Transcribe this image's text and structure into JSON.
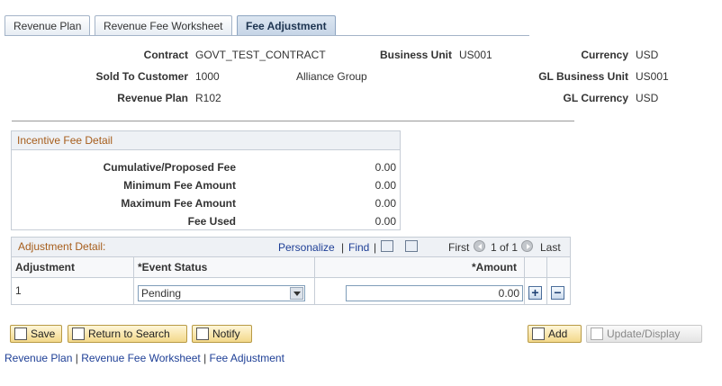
{
  "tabs": [
    {
      "label": "Revenue Plan",
      "active": false
    },
    {
      "label": "Revenue Fee Worksheet",
      "active": false
    },
    {
      "label": "Fee Adjustment",
      "active": true
    }
  ],
  "header": {
    "contract_label": "Contract",
    "contract_value": "GOVT_TEST_CONTRACT",
    "business_unit_label": "Business Unit",
    "business_unit_value": "US001",
    "currency_label": "Currency",
    "currency_value": "USD",
    "sold_to_label": "Sold To Customer",
    "sold_to_value": "1000",
    "sold_to_name": "Alliance Group",
    "gl_bu_label": "GL Business Unit",
    "gl_bu_value": "US001",
    "revenue_plan_label": "Revenue Plan",
    "revenue_plan_value": "R102",
    "gl_currency_label": "GL Currency",
    "gl_currency_value": "USD"
  },
  "incentive": {
    "title": "Incentive Fee Detail",
    "rows": [
      {
        "label": "Cumulative/Proposed Fee",
        "value": "0.00"
      },
      {
        "label": "Minimum Fee Amount",
        "value": "0.00"
      },
      {
        "label": "Maximum Fee Amount",
        "value": "0.00"
      },
      {
        "label": "Fee Used",
        "value": "0.00"
      }
    ]
  },
  "adjustment": {
    "title": "Adjustment Detail:",
    "personalize": "Personalize",
    "find": "Find",
    "first": "First",
    "range": "1 of 1",
    "last": "Last",
    "col_adjustment": "Adjustment",
    "col_event_status": "*Event Status",
    "col_amount": "*Amount",
    "row": {
      "adjustment": "1",
      "event_status": "Pending",
      "amount": "0.00"
    }
  },
  "buttons": {
    "save": "Save",
    "return": "Return to Search",
    "notify": "Notify",
    "add": "Add",
    "update": "Update/Display"
  },
  "bottom_links": [
    "Revenue Plan",
    "Revenue Fee Worksheet",
    "Fee Adjustment"
  ],
  "colors": {
    "accent_title": "#a65d1b",
    "link": "#1e3f96"
  }
}
